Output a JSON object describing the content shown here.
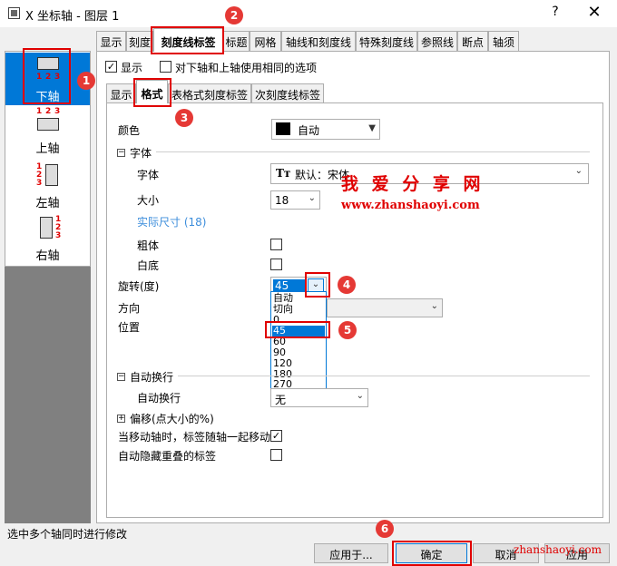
{
  "window": {
    "title": "X 坐标轴 - 图层 1",
    "help": "?",
    "close": "✕"
  },
  "axis_list": [
    {
      "label": "下轴",
      "selected": true
    },
    {
      "label": "上轴",
      "selected": false
    },
    {
      "label": "左轴",
      "selected": false
    },
    {
      "label": "右轴",
      "selected": false
    }
  ],
  "axis_icon_digits": [
    "1",
    "2",
    "3"
  ],
  "tabs": [
    "显示",
    "刻度",
    "刻度线标签",
    "标题",
    "网格",
    "轴线和刻度线",
    "特殊刻度线",
    "参照线",
    "断点",
    "轴须"
  ],
  "show_row": {
    "show_label": "显示",
    "show_checked": true,
    "same_label": "对下轴和上轴使用相同的选项",
    "same_checked": false
  },
  "subtabs": [
    "显示",
    "格式",
    "表格式刻度标签",
    "次刻度线标签"
  ],
  "format": {
    "color_label": "颜色",
    "color_value": "自动",
    "color_hex": "#000000",
    "font_group": "字体",
    "font_label": "字体",
    "font_value": "默认：宋体",
    "size_label": "大小",
    "size_value": "18",
    "actual_size": "实际尺寸 (18)",
    "bold_label": "粗体",
    "underline_label": "白底",
    "rotation_label": "旋转(度)",
    "rotation_value": "45",
    "direction_label": "方向",
    "position_label": "位置",
    "wrap_group": "自动换行",
    "wrap_label": "自动换行",
    "wrap_value": "无",
    "offset_group": "偏移(点大小的%)",
    "move_label": "当移动轴时，标签随轴一起移动",
    "move_checked": true,
    "hide_label": "自动隐藏重叠的标签",
    "hide_checked": false
  },
  "rotation_options": [
    "自动",
    "切向",
    "0",
    "45",
    "60",
    "90",
    "120",
    "180",
    "270"
  ],
  "rotation_selected_index": 3,
  "status_text": "选中多个轴同时进行修改",
  "buttons": {
    "apply_to": "应用于...",
    "ok": "确定",
    "cancel": "取消",
    "apply": "应用"
  },
  "callouts": [
    "1",
    "2",
    "3",
    "4",
    "5",
    "6"
  ],
  "watermark": {
    "cn": "我 爱 分 享 网",
    "url": "www.zhanshaoyi.com",
    "url2": "zhanshaoyi.com"
  },
  "colors": {
    "accent": "#0078d7",
    "callout": "#e53935",
    "highlight_box": "#e00000"
  }
}
